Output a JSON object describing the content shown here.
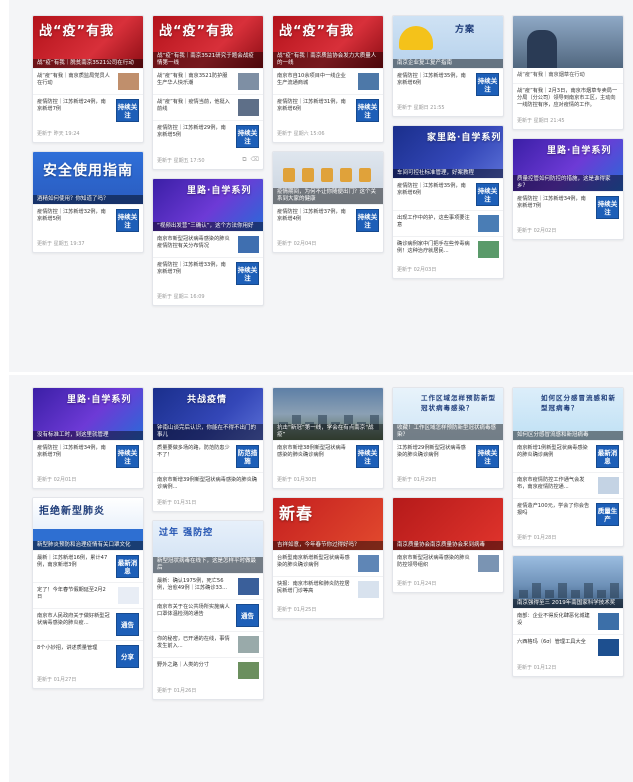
{
  "colors": {
    "badge": "#1d5fb8",
    "background": "#f4f5f7",
    "card": "#ffffff"
  },
  "sections": [
    {
      "columns": [
        [
          {
            "cover": {
              "type": "red",
              "headline": "战“疫”有我",
              "caption": "战“疫”有我｜脱贫南京3521公司在行动"
            },
            "rows": [
              {
                "text": "战“疫”有我｜南京质监局党员人在行动",
                "side": "thumb",
                "thumb": "#c08f6c"
              },
              {
                "text": "疫情防控｜江苏新增24例，南京新增7例",
                "side": "badge",
                "badge": "持续关注"
              }
            ],
            "footer": "更新于 昨天 19:24",
            "icons": false
          },
          {
            "cover": {
              "type": "blue-guide",
              "headline": "安全使用指南",
              "caption": "酒精如何使用？你知道了吗？"
            },
            "rows": [
              {
                "text": "疫情防控｜江苏新增32例，南京新增5例",
                "side": "badge",
                "badge": "持续关注"
              }
            ],
            "footer": "更新于 星期五 19:37",
            "icons": false
          }
        ],
        [
          {
            "cover": {
              "type": "red",
              "headline": "战“疫”有我",
              "caption": "战“疫”有我｜南京3521研究于题会战疫情第一线"
            },
            "rows": [
              {
                "text": "战“疫”有我｜南京3521防护服生产华人快乐潮",
                "side": "thumb",
                "thumb": "#7e8fa4"
              },
              {
                "text": "战“疫”有我｜疫情当前，他挺入前线",
                "side": "thumb",
                "thumb": "#5e6f88"
              },
              {
                "text": "疫情防控｜江苏新增29例，南京新增5例",
                "side": "badge",
                "badge": "持续关注"
              }
            ],
            "footer": "更新于 星期五 17:50",
            "icons": true
          },
          {
            "cover": {
              "type": "purple",
              "headline": "里路·自学系列",
              "caption": "“视频出发营”三确认”，这个方法你用好"
            },
            "rows": [
              {
                "text": "南京市新型冠状病毒感染的肺炎疫情防控有关分布情况",
                "side": "thumb",
                "thumb": "#3f6fb0"
              },
              {
                "text": "疫情防控｜江苏新增33例，南京新增7例",
                "side": "badge",
                "badge": "持续关注"
              }
            ],
            "footer": "更新于 星期三 16:09",
            "icons": false
          }
        ],
        [
          {
            "cover": {
              "type": "red",
              "headline": "战“疫”有我",
              "caption": "战“疫”有我｜南京质监协会发力大质量人的一线"
            },
            "rows": [
              {
                "text": "南京市自10余项目中一线企业生产流通商城",
                "side": "thumb",
                "thumb": "#4d78a8"
              },
              {
                "text": "疫情防控｜江苏新增31例，南京新增6例",
                "side": "badge",
                "badge": "持续关注"
              }
            ],
            "footer": "更新于 星期六 15:06",
            "icons": false
          },
          {
            "cover": {
              "type": "locks",
              "headline": "",
              "caption": "疫情期间，为何不让你随便出门？这个关系到大家的健康"
            },
            "rows": [
              {
                "text": "疫情防控｜江苏新增37例，南京新增4例",
                "side": "badge",
                "badge": "持续关注"
              }
            ],
            "footer": "更新于 02月04日",
            "icons": false
          }
        ],
        [
          {
            "cover": {
              "type": "helmet",
              "headline": "方案",
              "caption": "南京企业复工复产指南"
            },
            "rows": [
              {
                "text": "疫情防控｜江苏新增35例，南京新增6例",
                "side": "badge",
                "badge": "持续关注"
              }
            ],
            "footer": "更新于 星期日 21:55",
            "icons": false
          },
          {
            "cover": {
              "type": "navy",
              "headline": "家里路·自学系列",
              "caption": "车间可控社标准管理，好案教程"
            },
            "rows": [
              {
                "text": "疫情防控｜江苏新增35例，南京新增6例",
                "side": "badge",
                "badge": "持续关注"
              },
              {
                "text": "出现工作中的护，这些事项要注意",
                "side": "thumb",
                "thumb": "#4a7db5"
              },
              {
                "text": "确诊病例家中门把手在些传毒病例！这种治疗就居民...",
                "side": "thumb",
                "thumb": "#5a9a6a"
              }
            ],
            "footer": "更新于 02月03日",
            "icons": false
          }
        ],
        [
          {
            "cover": {
              "type": "photo",
              "headline": "",
              "caption": ""
            },
            "note": "战“疫”有我｜南京烟草在行动",
            "rows": [
              {
                "text": "战“疫”有我｜2月3日，南京市烟草专卖局一分局（分公司）领导到南京市工区，主动向一线防控有序，应对疫情的工作。",
                "side": "none"
              }
            ],
            "footer": "更新于 星期日 21:45",
            "icons": false
          },
          {
            "cover": {
              "type": "purple",
              "headline": "里路·自学系列",
              "caption": "质量控管如何防控的措施，这是谁得家乡？"
            },
            "rows": [
              {
                "text": "疫情防控｜江苏新增34例，南京新增7例",
                "side": "badge",
                "badge": "持续关注"
              }
            ],
            "footer": "更新于 02月02日",
            "icons": false
          }
        ]
      ]
    },
    {
      "columns": [
        [
          {
            "cover": {
              "type": "purple",
              "headline": "里路·自学系列",
              "caption": "没有标准工时，到这里就管理"
            },
            "rows": [
              {
                "text": "疫情防控｜江苏新增34例，南京新增7例",
                "side": "badge",
                "badge": "持续关注"
              }
            ],
            "footer": "更新于 02月01日",
            "icons": false
          },
          {
            "cover": {
              "type": "blue-banner",
              "headline": "拒绝新型肺炎",
              "caption": "新型肺炎预防和治理疫情有关口罩文化"
            },
            "rows": [
              {
                "text": "最新｜江苏新增16例，累计47例，南京新增3例",
                "side": "badge",
                "badge": "最新消息"
              },
              {
                "text": "定了！今年春节假期延至2月2日",
                "side": "thumb",
                "thumb": "#e8edf5"
              },
              {
                "text": "南京市人民政府关于做好新型冠状病毒感染的肺炎疫...",
                "side": "badge",
                "badge": "通告"
              },
              {
                "text": "8个小妙招，讲述质量管理",
                "side": "badge",
                "badge": "分享"
              }
            ],
            "footer": "更新于 01月27日",
            "icons": false
          }
        ],
        [
          {
            "cover": {
              "type": "navy",
              "headline": "共战疫情",
              "caption": "钟南山谈完后认识，你能在不得不出门的事儿"
            },
            "rows": [
              {
                "text": "质量要做多场的路，防范防患少不了！",
                "side": "badge",
                "badge": "防范措施"
              },
              {
                "text": "南京市新增39例新型冠状病毒感染的肺炎确诊病例...",
                "side": "none"
              }
            ],
            "footer": "更新于 01月31日",
            "icons": false
          },
          {
            "cover": {
              "type": "new-year",
              "headline": "过年 强防控",
              "caption": "新型冠状病毒在线下，这是怎样平时做最后"
            },
            "rows": [
              {
                "text": "最新：确认1975例，死亡56例，治愈49例｜江苏确诊33...",
                "side": "thumb",
                "thumb": "#3a5f9a"
              },
              {
                "text": "南京市关于在公共场所实施病人口罩体温检测的通告",
                "side": "badge",
                "badge": "通告"
              },
              {
                "text": "你的秘密，已开通的在线，事情发生前入...",
                "side": "thumb",
                "thumb": "#9aa"
              },
              {
                "text": "野外之路｜人类的分寸",
                "side": "thumb",
                "thumb": "#6b8f5e"
              }
            ],
            "footer": "更新于 01月26日",
            "icons": false
          }
        ],
        [
          {
            "cover": {
              "type": "city",
              "headline": "",
              "caption": "抗击“新冠”第一线，学会在有点南京“战疫”"
            },
            "rows": [
              {
                "text": "南京市新增38例新型冠状病毒感染的肺炎确诊病例",
                "side": "badge",
                "badge": "持续关注"
              }
            ],
            "footer": "更新于 01月30日",
            "icons": false
          },
          {
            "cover": {
              "type": "spring",
              "headline": "新春",
              "caption": "吉祥如意，今年春节你过得好吗？"
            },
            "rows": [
              {
                "text": "台新型南京新增新型冠状病毒感染的肺炎确诊病例",
                "side": "thumb",
                "thumb": "#5f86b6"
              },
              {
                "text": "快报：南京市新增和肺炎防控居民新增门诊等高",
                "side": "thumb",
                "thumb": "#d8e2ee"
              }
            ],
            "footer": "更新于 01月25日",
            "icons": false
          }
        ],
        [
          {
            "cover": {
              "type": "cartoon",
              "headline": "工作区域怎样预防新型冠状病毒感染？",
              "caption": "收藏！工作区域怎样预防新型冠状病毒感染？"
            },
            "rows": [
              {
                "text": "江苏新增29例新型冠状病毒感染的肺炎确诊病例",
                "side": "badge",
                "badge": "持续关注"
              }
            ],
            "footer": "更新于 01月29日",
            "icons": false
          },
          {
            "cover": {
              "type": "red-soldier",
              "headline": "",
              "caption": "南京质量协会南京质量协会来到病毒"
            },
            "rows": [
              {
                "text": "南京市新型冠状病毒感染的肺炎防控领导组织",
                "side": "thumb",
                "thumb": "#7a94b3"
              }
            ],
            "footer": "更新于 01月24日",
            "icons": false
          }
        ],
        [
          {
            "cover": {
              "type": "cartoon2",
              "headline": "如何区分感冒流感和新型冠病毒？",
              "caption": "如何区分感冒流感和新冠病毒"
            },
            "rows": [
              {
                "text": "南京新增1例新型冠状病毒感染的肺炎确诊病例",
                "side": "badge",
                "badge": "最新消息"
              },
              {
                "text": "南京市疫情防控工作通气会发布，南京疫情防控通...",
                "side": "thumb",
                "thumb": "#c4d3e4"
              },
              {
                "text": "疫情造产100元，学会了你会告报吗",
                "side": "badge",
                "badge": "质量生产"
              }
            ],
            "footer": "更新于 01月28日",
            "icons": false
          },
          {
            "cover": {
              "type": "skyline",
              "headline": "",
              "caption": "南京强得至三 2019年南国家科学技术奖"
            },
            "rows": [
              {
                "text": "南部：企业不得反化肆恶化城建设",
                "side": "thumb",
                "thumb": "#3c6fa8"
              },
              {
                "text": "六西格玛（6σ）管理工具大全",
                "side": "thumb",
                "thumb": "#1d4f8f"
              }
            ],
            "footer": "更新于 01月12日",
            "icons": false
          }
        ]
      ]
    }
  ]
}
